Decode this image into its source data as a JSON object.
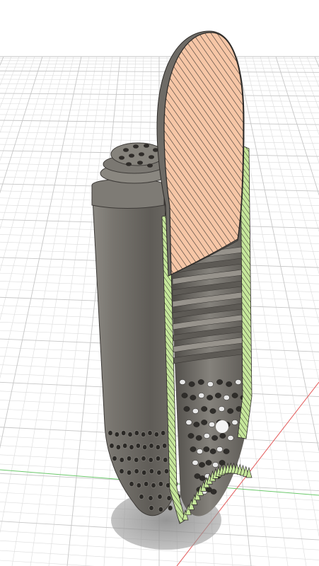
{
  "viewport": {
    "background": "#ffffff",
    "grid_minor_color": "#dcdcdc",
    "grid_major_color": "#c6c6c6",
    "axis_x_color": "#e35a5a",
    "axis_y_color": "#6bc86b"
  },
  "model": {
    "body_color": "#6e6b66",
    "body_dark_color": "#45423f",
    "body_light_color": "#9a968f",
    "cap_section_color": "#f6c6a6",
    "wall_section_color": "#c6e79b",
    "hatch_color": "#2e2b28"
  }
}
